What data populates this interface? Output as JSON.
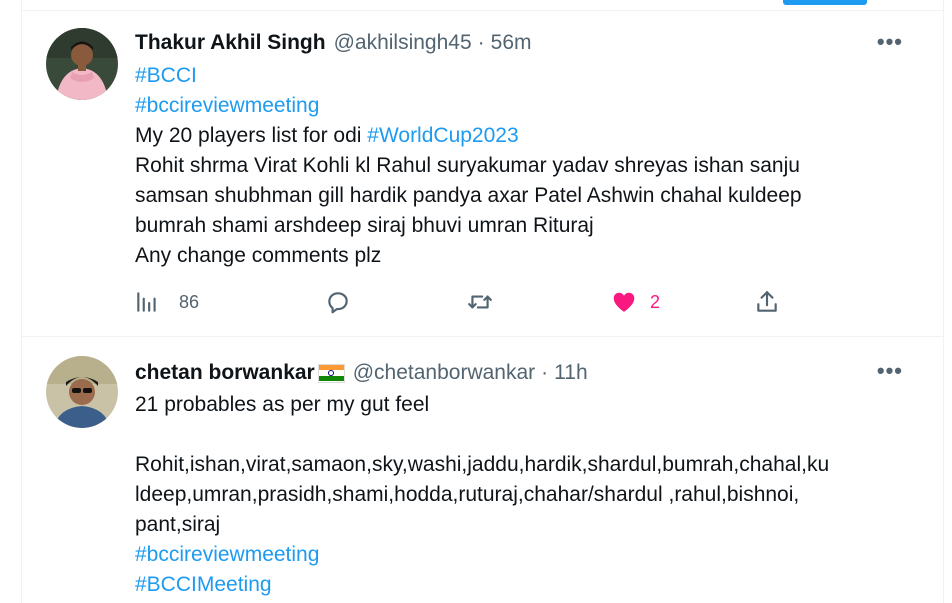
{
  "tweets": [
    {
      "name": "Thakur Akhil Singh",
      "handle": "@akhilsingh45",
      "separator": "·",
      "time": "56m",
      "more": "•••",
      "avatar_icon": "user-photo-avatar",
      "tag1": "#BCCI",
      "tag2": "#bccireviewmeeting",
      "line3_text": "My 20 players list for odi ",
      "line3_tag": "#WorldCup2023",
      "line4": "Rohit shrma Virat Kohli kl Rahul suryakumar yadav shreyas ishan sanju",
      "line5": "samsan shubhman gill hardik pandya axar Patel Ashwin chahal kuldeep",
      "line6": "bumrah shami arshdeep siraj bhuvi umran Rituraj",
      "line7": "Any change comments plz",
      "actions": {
        "views_icon": "analytics-icon",
        "views": "86",
        "reply_icon": "reply-icon",
        "retweet_icon": "retweet-icon",
        "like_icon": "heart-filled-icon",
        "likes": "2",
        "share_icon": "share-icon"
      }
    },
    {
      "name": "chetan borwankar",
      "flag_icon": "india-flag-icon",
      "handle": "@chetanborwankar",
      "separator": "·",
      "time": "11h",
      "more": "•••",
      "avatar_icon": "user-photo-avatar",
      "line1": "21 probables as per my gut feel",
      "line2": "Rohit,ishan,virat,samaon,sky,washi,jaddu,hardik,shardul,bumrah,chahal,ku",
      "line3": "ldeep,umran,prasidh,shami,hodda,ruturaj,chahar/shardul ,rahul,bishnoi,",
      "line4": "pant,siraj",
      "tag1": "#bccireviewmeeting",
      "tag2": "#BCCIMeeting"
    }
  ],
  "colors": {
    "accent": "#1d9bf0",
    "like": "#f91880",
    "muted": "#536471",
    "text": "#0f1419"
  }
}
